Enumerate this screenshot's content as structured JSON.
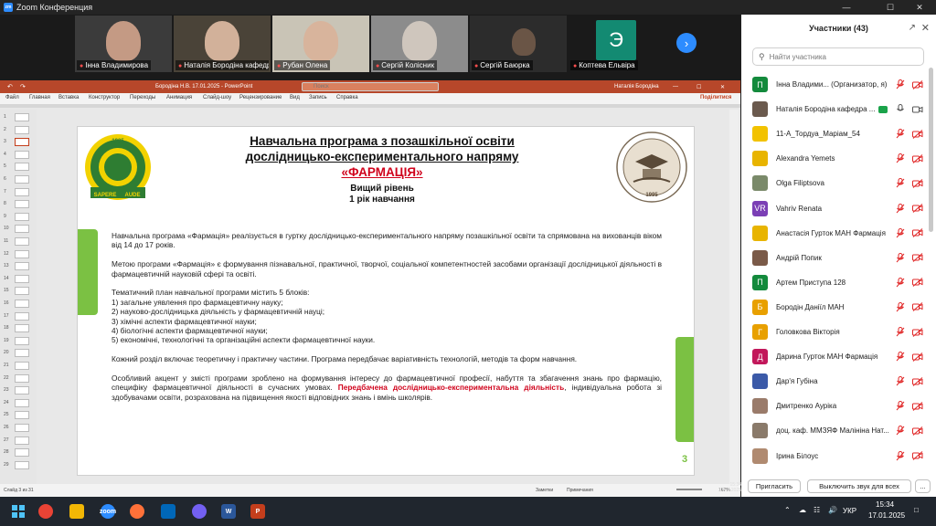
{
  "window": {
    "title": "Zoom Конференция",
    "app_badge": "zm"
  },
  "gallery": [
    {
      "name": "Інна Владимирова",
      "muted": true
    },
    {
      "name": "Наталія Бородіна кафедр...",
      "muted": true
    },
    {
      "name": "Рубан Олена",
      "muted": true
    },
    {
      "name": "Сергій Колісник",
      "muted": true
    },
    {
      "name": "Сергій Баюрка",
      "muted": true
    },
    {
      "name": "Коптева Ельвіра",
      "muted": true,
      "initial": "Э"
    }
  ],
  "ppt": {
    "title": "Бородіна Н.В.  17.01.2025  -  PowerPoint",
    "search": "Поиск",
    "user": "Наталія Бородіна",
    "share": "Поділитися",
    "menu": [
      "Файл",
      "Главная",
      "Вставка",
      "Конструктор",
      "Переходы",
      "Анимация",
      "Слайд-шоу",
      "Рецензирование",
      "Вид",
      "Запись",
      "Справка"
    ],
    "status_left": "Слайд 3 из 31",
    "status_notes": "Заметки",
    "status_comments": "Примечания",
    "zoom": "167%",
    "slide_numbers": [
      "1",
      "2",
      "3",
      "4",
      "5",
      "6",
      "7",
      "8",
      "9",
      "10",
      "11",
      "12",
      "13",
      "14",
      "15",
      "16",
      "17",
      "18",
      "19",
      "20",
      "21",
      "22",
      "23",
      "24",
      "25",
      "26",
      "27",
      "28",
      "29"
    ],
    "active_slide": "3"
  },
  "slide": {
    "title_line1": "Навчальна програма з позашкільної освіти",
    "title_line2": "дослідницько-експериментального напряму",
    "title_red": "«ФАРМАЦІЯ»",
    "level": "Вищий рівень",
    "year": "1 рік навчання",
    "logo_left_year": "1905",
    "logo_left_motto1": "SAPERE",
    "logo_left_motto2": "AUDE",
    "logo_right_year": "1995",
    "p1": "Навчальна програма «Фармація» реалізується в гуртку дослідницько-експериментального напряму позашкільної освіти та спрямована на вихованців віком від 14 до 17 років.",
    "p2": "Метою програми «Фармація» є формування пізнавальної, практичної, творчої, соціальної компетентностей засобами організації дослідницької діяльності в фармацевтичній науковій сфері та освіті.",
    "p3_intro": "Тематичний план навчальної програми містить 5 блоків:",
    "p3_items": [
      "1) загальне уявлення про фармацевтичну науку;",
      "2) науково-дослідницька діяльність у фармацевтичній науці;",
      "3) хімічні аспекти фармацевтичної науки;",
      "4) біологічні аспекти фармацевтичної науки;",
      "5) економічні, технологічні та організаційні аспекти фармацевтичної науки."
    ],
    "p4": "Кожний розділ включає теоретичну і практичну частини. Програма передбачає варіативність технологій, методів та  форм навчання.",
    "p5_a": "Особливий акцент у змісті програми зроблено на формування інтересу до фармацевтичної професії, набуття та збагачення знань про фармацію, специфіку фармацевтичної діяльності в сучасних умовах.",
    "p5_red": "Передбачена дослідницько-експериментальна діяльність",
    "p5_b": ", індивідуальна робота зі здобувачами освіти, розрахована на підвищення якості відповідних знань і вмінь школярів.",
    "page_number": "3"
  },
  "participants": {
    "header": "Участники (43)",
    "search_placeholder": "Найти участника",
    "list": [
      {
        "name": "Інна Владими...  (Организатор, я)",
        "initial": "П",
        "color": "#138a3c",
        "mic": "muted",
        "video": "off"
      },
      {
        "name": "Наталія Бородіна кафедра ...",
        "initial": "",
        "color": "#6b5a4e",
        "mic": "on",
        "video": "on",
        "sharing": true
      },
      {
        "name": "11-А_Тордуа_Маріам_54",
        "initial": "",
        "color": "#f2c200",
        "mic": "muted",
        "video": "off"
      },
      {
        "name": "Alexandra Yemets",
        "initial": "",
        "color": "#e8b400",
        "mic": "muted",
        "video": "off"
      },
      {
        "name": "Olga Filiptsova",
        "initial": "",
        "color": "#7a8a6a",
        "mic": "muted",
        "video": "off"
      },
      {
        "name": "Vahriv Renata",
        "initial": "VR",
        "color": "#7b3fb5",
        "mic": "muted",
        "video": "off"
      },
      {
        "name": "Анастасія Гурток МАН Фармація",
        "initial": "",
        "color": "#e8b400",
        "mic": "muted",
        "video": "off"
      },
      {
        "name": "Андрій Попик",
        "initial": "",
        "color": "#7a5a48",
        "mic": "muted",
        "video": "off"
      },
      {
        "name": "Артем Приступа 128",
        "initial": "П",
        "color": "#138a3c",
        "mic": "muted",
        "video": "off"
      },
      {
        "name": "Бородін Даніїл МАН",
        "initial": "Б",
        "color": "#e8a000",
        "mic": "muted",
        "video": "off"
      },
      {
        "name": "Головкова Вікторія",
        "initial": "Г",
        "color": "#e8a000",
        "mic": "muted",
        "video": "off"
      },
      {
        "name": "Дарина Гурток МАН Фармація",
        "initial": "Д",
        "color": "#c2185b",
        "mic": "muted",
        "video": "off"
      },
      {
        "name": "Дар'я Губіна",
        "initial": "",
        "color": "#3b5aa8",
        "mic": "muted",
        "video": "off"
      },
      {
        "name": "Дмитренко Ауріка",
        "initial": "",
        "color": "#9a7b6a",
        "mic": "muted",
        "video": "off"
      },
      {
        "name": "доц. каф. ММЗЯФ Малініна Нат...",
        "initial": "",
        "color": "#8a7a6a",
        "mic": "muted",
        "video": "off"
      },
      {
        "name": "Ірина Білоус",
        "initial": "",
        "color": "#b08a70",
        "mic": "muted",
        "video": "off"
      }
    ],
    "invite_label": "Пригласить",
    "mute_all_label": "Выключить звук для всех",
    "more_label": "..."
  },
  "taskbar": {
    "lang": "УКР",
    "time": "15:34",
    "date": "17.01.2025",
    "ppt_time": "15:34",
    "ppt_date": "17.01.2025"
  },
  "colors": {
    "zoom_accent": "#2d8cff",
    "ppt_accent": "#b7472a",
    "slide_green": "#7bc143",
    "slide_red": "#d0021b",
    "muted_red": "#e02828"
  }
}
